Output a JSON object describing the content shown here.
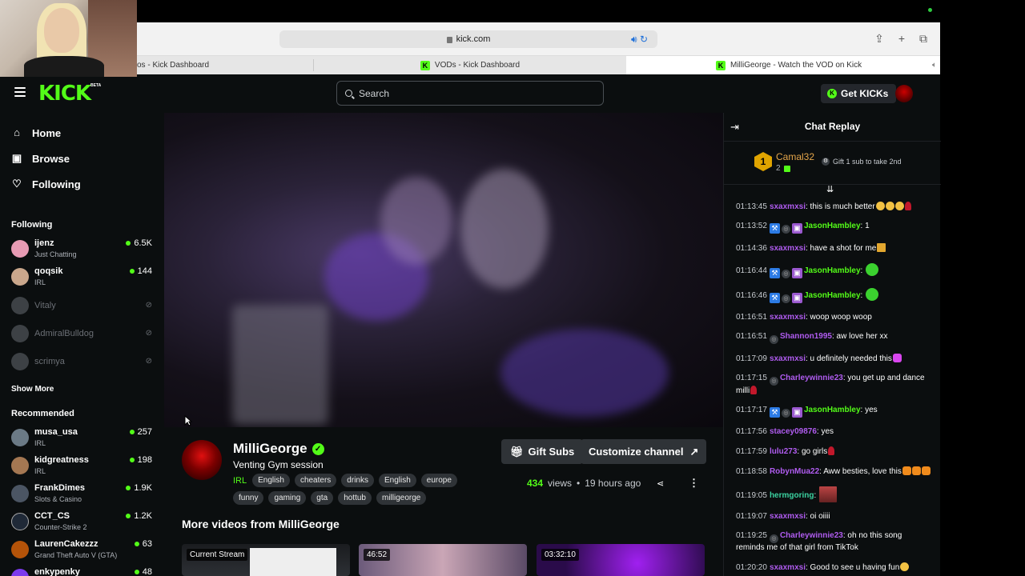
{
  "browser": {
    "url": "kick.com",
    "tabs": [
      {
        "label": "os - Kick Dashboard"
      },
      {
        "label": "VODs - Kick Dashboard"
      },
      {
        "label": "MilliGeorge - Watch the VOD on Kick"
      }
    ]
  },
  "header": {
    "search_placeholder": "Search",
    "get_kicks_label": "Get KICKs",
    "logo": "KICK",
    "logo_badge": "BETA"
  },
  "sidebar": {
    "nav": [
      {
        "label": "Home",
        "icon": "home-icon"
      },
      {
        "label": "Browse",
        "icon": "browse-icon"
      },
      {
        "label": "Following",
        "icon": "heart-icon"
      }
    ],
    "following_heading": "Following",
    "following": [
      {
        "name": "ijenz",
        "category": "Just Chatting",
        "viewers": "6.5K",
        "live": true,
        "avatar_color": "#e89bb4"
      },
      {
        "name": "qoqsik",
        "category": "IRL",
        "viewers": "144",
        "live": true,
        "avatar_color": "#caa78c"
      },
      {
        "name": "Vitaly",
        "live": false,
        "avatar_color": "#8a8f96"
      },
      {
        "name": "AdmiralBulldog",
        "live": false,
        "avatar_color": "#8a8f96"
      },
      {
        "name": "scrimya",
        "live": false,
        "avatar_color": "#8a8f96"
      }
    ],
    "show_more": "Show More",
    "recommended_heading": "Recommended",
    "recommended": [
      {
        "name": "musa_usa",
        "category": "IRL",
        "viewers": "257",
        "avatar_color": "#6b7a86"
      },
      {
        "name": "kidgreatness",
        "category": "IRL",
        "viewers": "198",
        "avatar_color": "#a47752"
      },
      {
        "name": "FrankDimes",
        "category": "Slots & Casino",
        "viewers": "1.9K",
        "avatar_color": "#4b5563"
      },
      {
        "name": "CCT_CS",
        "category": "Counter-Strike 2",
        "viewers": "1.2K",
        "avatar_color": "#1f2937"
      },
      {
        "name": "LaurenCakezzz",
        "category": "Grand Theft Auto V (GTA)",
        "viewers": "63",
        "avatar_color": "#b45309"
      },
      {
        "name": "enkypenky",
        "category": "",
        "viewers": "48",
        "avatar_color": "#7c3aed"
      }
    ]
  },
  "channel": {
    "name": "MilliGeorge",
    "title": "Venting Gym session",
    "category": "IRL",
    "tags_row1": [
      "English",
      "cheaters",
      "drinks",
      "English",
      "europe"
    ],
    "tags_row2": [
      "funny",
      "gaming",
      "gta",
      "hottub",
      "milligeorge"
    ],
    "gift_subs_label": "Gift Subs",
    "customize_label": "Customize channel",
    "views": "434",
    "views_label": "views",
    "separator": "•",
    "age": "19 hours ago",
    "more_videos_title": "More videos from MilliGeorge",
    "videos": [
      {
        "badge": "Current Stream"
      },
      {
        "badge": "46:52"
      },
      {
        "badge": "03:32:10"
      }
    ]
  },
  "chat": {
    "title": "Chat Replay",
    "pinned": {
      "rank": "1",
      "user": "Camal32",
      "count": "2",
      "goal_text": "Gift 1 sub to take 2nd"
    },
    "messages": [
      {
        "ts": "01:13:45",
        "user": "sxaxmxsi",
        "color": "#b05cf0",
        "text": "this is much better",
        "emotes": [
          "yellow",
          "yellow",
          "yellow",
          "rose"
        ],
        "badges": []
      },
      {
        "ts": "01:13:52",
        "user": "JasonHambley",
        "color": "#53fc18",
        "text": "1",
        "emotes": [],
        "badges": [
          "blue",
          "grey",
          "gift"
        ]
      },
      {
        "ts": "01:14:36",
        "user": "sxaxmxsi",
        "color": "#b05cf0",
        "text": "have a shot for me",
        "emotes": [
          "beer"
        ],
        "badges": []
      },
      {
        "ts": "01:16:44",
        "user": "JasonHambley",
        "color": "#53fc18",
        "text": "",
        "emotes": [
          "green"
        ],
        "badges": [
          "blue",
          "grey",
          "gift"
        ]
      },
      {
        "ts": "01:16:46",
        "user": "JasonHambley",
        "color": "#53fc18",
        "text": "",
        "emotes": [
          "green"
        ],
        "badges": [
          "blue",
          "grey",
          "gift"
        ]
      },
      {
        "ts": "01:16:51",
        "user": "sxaxmxsi",
        "color": "#b05cf0",
        "text": "woop woop woop",
        "emotes": [],
        "badges": []
      },
      {
        "ts": "01:16:51",
        "user": "Shannon1995",
        "color": "#b05cf0",
        "text": "aw love her xx",
        "emotes": [],
        "badges": [
          "grey"
        ]
      },
      {
        "ts": "01:17:09",
        "user": "sxaxmxsi",
        "color": "#b05cf0",
        "text": "u definitely needed this",
        "emotes": [
          "heart"
        ],
        "badges": []
      },
      {
        "ts": "01:17:15",
        "user": "Charleywinnie23",
        "color": "#b05cf0",
        "text": "you get up and dance milli",
        "emotes": [
          "rose"
        ],
        "badges": [
          "grey"
        ]
      },
      {
        "ts": "01:17:17",
        "user": "JasonHambley",
        "color": "#53fc18",
        "text": "yes",
        "emotes": [],
        "badges": [
          "blue",
          "grey",
          "gift"
        ]
      },
      {
        "ts": "01:17:56",
        "user": "stacey09876",
        "color": "#b05cf0",
        "text": "yes",
        "emotes": [],
        "badges": []
      },
      {
        "ts": "01:17:59",
        "user": "lulu273",
        "color": "#b05cf0",
        "text": "go girls",
        "emotes": [
          "rose"
        ],
        "badges": []
      },
      {
        "ts": "01:18:58",
        "user": "RobynMua22",
        "color": "#b05cf0",
        "text": "Aww besties, love this",
        "emotes": [
          "orange",
          "orange",
          "orange"
        ],
        "badges": []
      },
      {
        "ts": "01:19:05",
        "user": "hermgoring",
        "color": "#3bd1a0",
        "text": "",
        "emotes": [
          "pic"
        ],
        "badges": []
      },
      {
        "ts": "01:19:07",
        "user": "sxaxmxsi",
        "color": "#b05cf0",
        "text": "oi oiiii",
        "emotes": [],
        "badges": []
      },
      {
        "ts": "01:19:25",
        "user": "Charleywinnie23",
        "color": "#b05cf0",
        "text": "oh no this song reminds me of that girl from TikTok",
        "emotes": [],
        "badges": [
          "grey"
        ]
      },
      {
        "ts": "01:20:20",
        "user": "sxaxmxsi",
        "color": "#b05cf0",
        "text": "Good to see u having fun",
        "emotes": [
          "yellow"
        ],
        "badges": []
      }
    ]
  },
  "colors": {
    "accent": "#53fc18",
    "bg": "#0b0e0f",
    "chip": "#2f3337"
  }
}
